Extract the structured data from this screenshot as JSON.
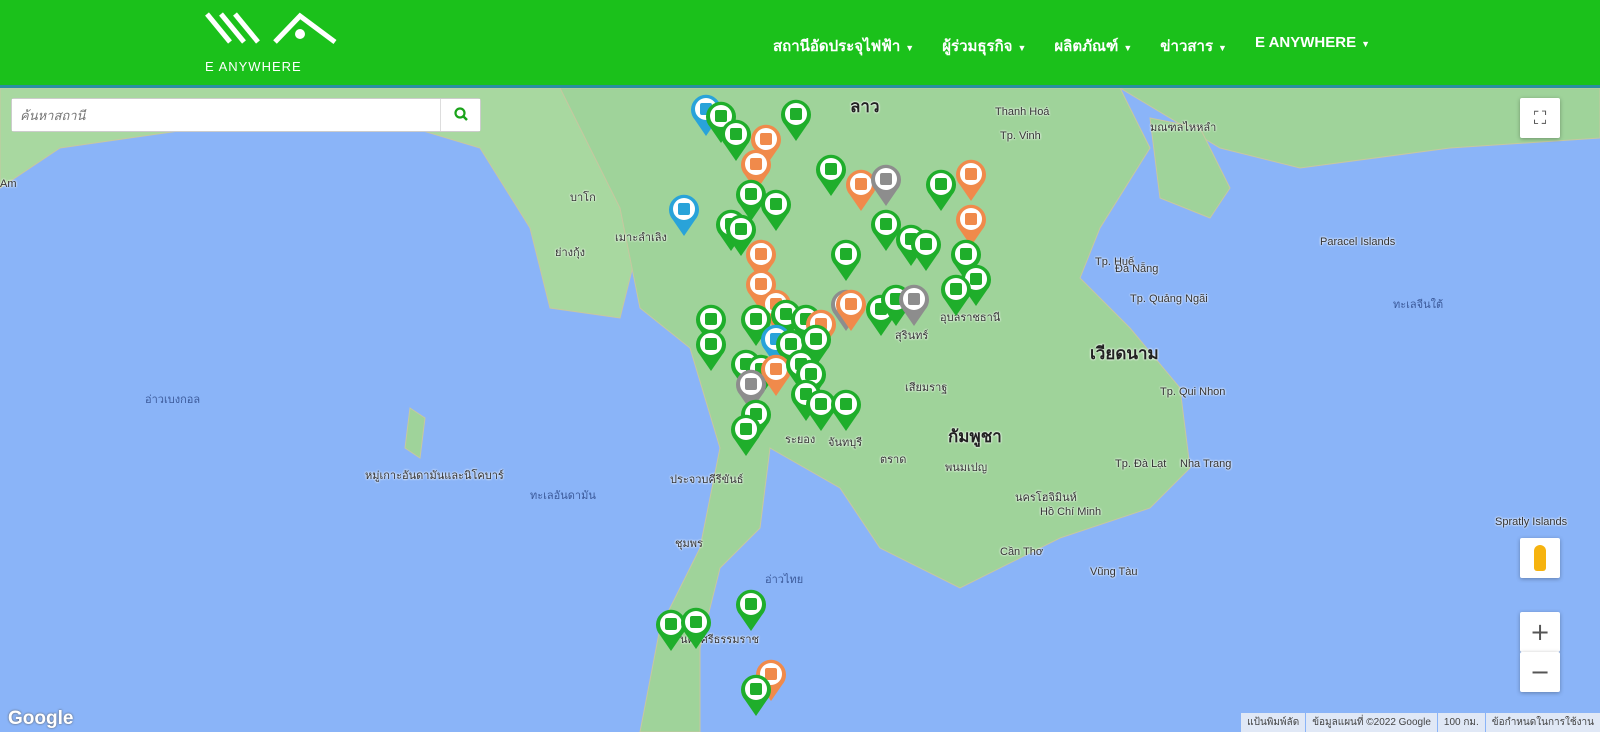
{
  "header": {
    "logo_text": "E ANYWHERE",
    "nav": [
      {
        "label": "สถานีอัดประจุไฟฟ้า"
      },
      {
        "label": "ผู้ร่วมธุรกิจ"
      },
      {
        "label": "ผลิตภัณฑ์"
      },
      {
        "label": "ข่าวสาร"
      },
      {
        "label": "E ANYWHERE"
      }
    ]
  },
  "search": {
    "placeholder": "ค้นหาสถานี"
  },
  "map": {
    "labels": {
      "laos": "ลาว",
      "cambodia": "กัมพูชา",
      "vietnam": "เวียดนาม",
      "gulf": "อ่าวไทย",
      "scs": "ทะเลจีนใต้",
      "bengal": "อ่าวเบงกอล",
      "andaman_is": "หมู่เกาะอันดามันและนิโคบาร์",
      "andaman_sea": "ทะเลอันดามัน",
      "hainan": "มณฑลไหหลำ",
      "thanhhoa": "Thanh Hoá",
      "vinh": "Tp. Vinh",
      "hue": "Tp. Huế",
      "danang": "Đà Nẵng",
      "quangngai": "Tp. Quảng Ngãi",
      "quinhon": "Tp. Qui Nhon",
      "dalat": "Tp. Đà Lạt",
      "nhatrang": "Nha Trang",
      "hcm": "Hồ Chí Minh",
      "cantho": "Cần Thơ",
      "vungtau": "Vũng Tàu",
      "paracel": "Paracel Islands",
      "spratly": "Spratly Islands",
      "phnompenh": "พนมเปญ",
      "siemreap": "เสียมราฐ",
      "prachuap": "ประจวบคีรีขันธ์",
      "chumphon": "ชุมพร",
      "surin": "สุรินทร์",
      "ubon": "อุบลราชธานี",
      "rayong": "ระยอง",
      "chanthaburi": "จันทบุรี",
      "trat": "ตราด",
      "yangon": "ย่างกุ้ง",
      "bago": "บาโก",
      "myawaddy": "เมาะลำเลิง",
      "nakhonsi": "นครศรีธรรมราช",
      "hcm_th": "นครโฮจิมินห์",
      "hongkong": "Am"
    },
    "attribution": {
      "shortcuts": "แป้นพิมพ์ลัด",
      "data": "ข้อมูลแผนที่ ©2022 Google",
      "scale": "100 กม.",
      "terms": "ข้อกำหนดในการใช้งาน"
    },
    "google": "Google",
    "colors": {
      "green": "#1fae2b",
      "orange": "#f08a4b",
      "gray": "#8d8d8d",
      "blue": "#29a3d9"
    }
  }
}
